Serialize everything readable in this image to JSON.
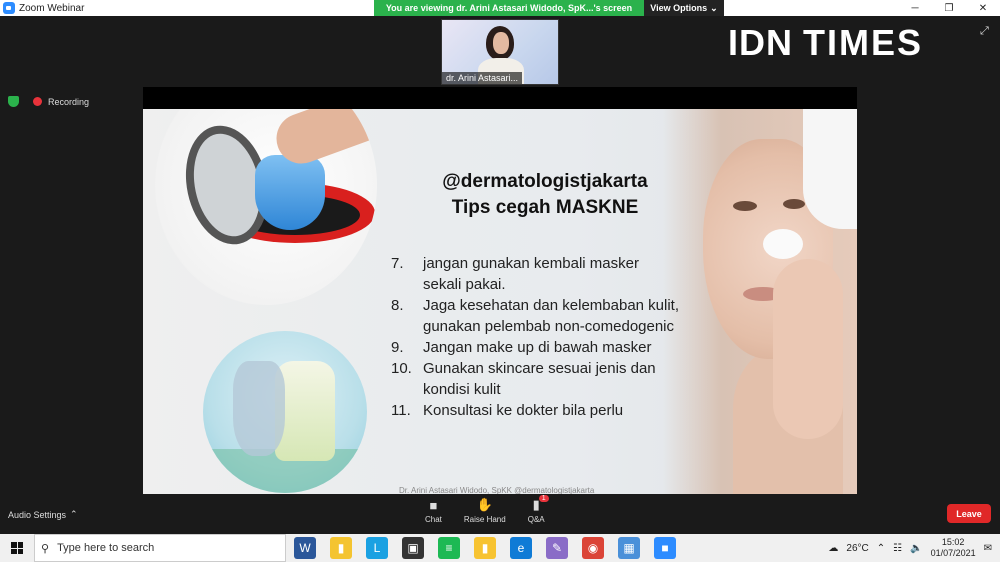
{
  "window": {
    "title": "Zoom Webinar",
    "controls": {
      "minimize": "─",
      "restore": "❐",
      "close": "✕"
    }
  },
  "banner": {
    "viewing_text": "You are viewing dr. Arini Astasari Widodo, SpK...'s screen",
    "options_label": "View Options",
    "options_chevron": "⌄"
  },
  "speaker": {
    "name": "dr. Arini Astasari..."
  },
  "watermark": {
    "left": "IDN",
    "right": "TIMES"
  },
  "status": {
    "recording_label": "Recording"
  },
  "slide": {
    "handle": "@dermatologistjakarta",
    "title": "Tips cegah MASKNE",
    "tips": [
      {
        "num": "7.",
        "text": "jangan gunakan kembali masker sekali pakai."
      },
      {
        "num": "8.",
        "text": "Jaga kesehatan dan kelembaban kulit, gunakan pelembab non-comedogenic"
      },
      {
        "num": "9.",
        "text": "Jangan make up di bawah masker"
      },
      {
        "num": "10.",
        "text": "Gunakan skincare sesuai jenis dan kondisi kulit"
      },
      {
        "num": "11.",
        "text": "Konsultasi ke dokter bila perlu"
      }
    ],
    "footer": "Dr. Arini Astasari Widodo, SpKK @dermatologistjakarta"
  },
  "controls": {
    "audio_settings": "Audio Settings",
    "audio_chevron": "⌃",
    "chat": "Chat",
    "raise_hand": "Raise Hand",
    "qa": "Q&A",
    "qa_badge": "1",
    "leave": "Leave"
  },
  "taskbar": {
    "search_placeholder": "Type here to search",
    "weather": "26°C",
    "time": "15:02",
    "date": "01/07/2021",
    "colors": {
      "word": "#2b579a",
      "files": "#f4c430",
      "lens": "#1ba1e2",
      "store": "#333333",
      "spotify": "#1db954",
      "sticky": "#f7c331",
      "edge": "#0f7bd6",
      "paint": "#8a6cc7",
      "chrome": "#db4437",
      "remote": "#4a90d9",
      "zoom": "#2d8cff"
    }
  }
}
